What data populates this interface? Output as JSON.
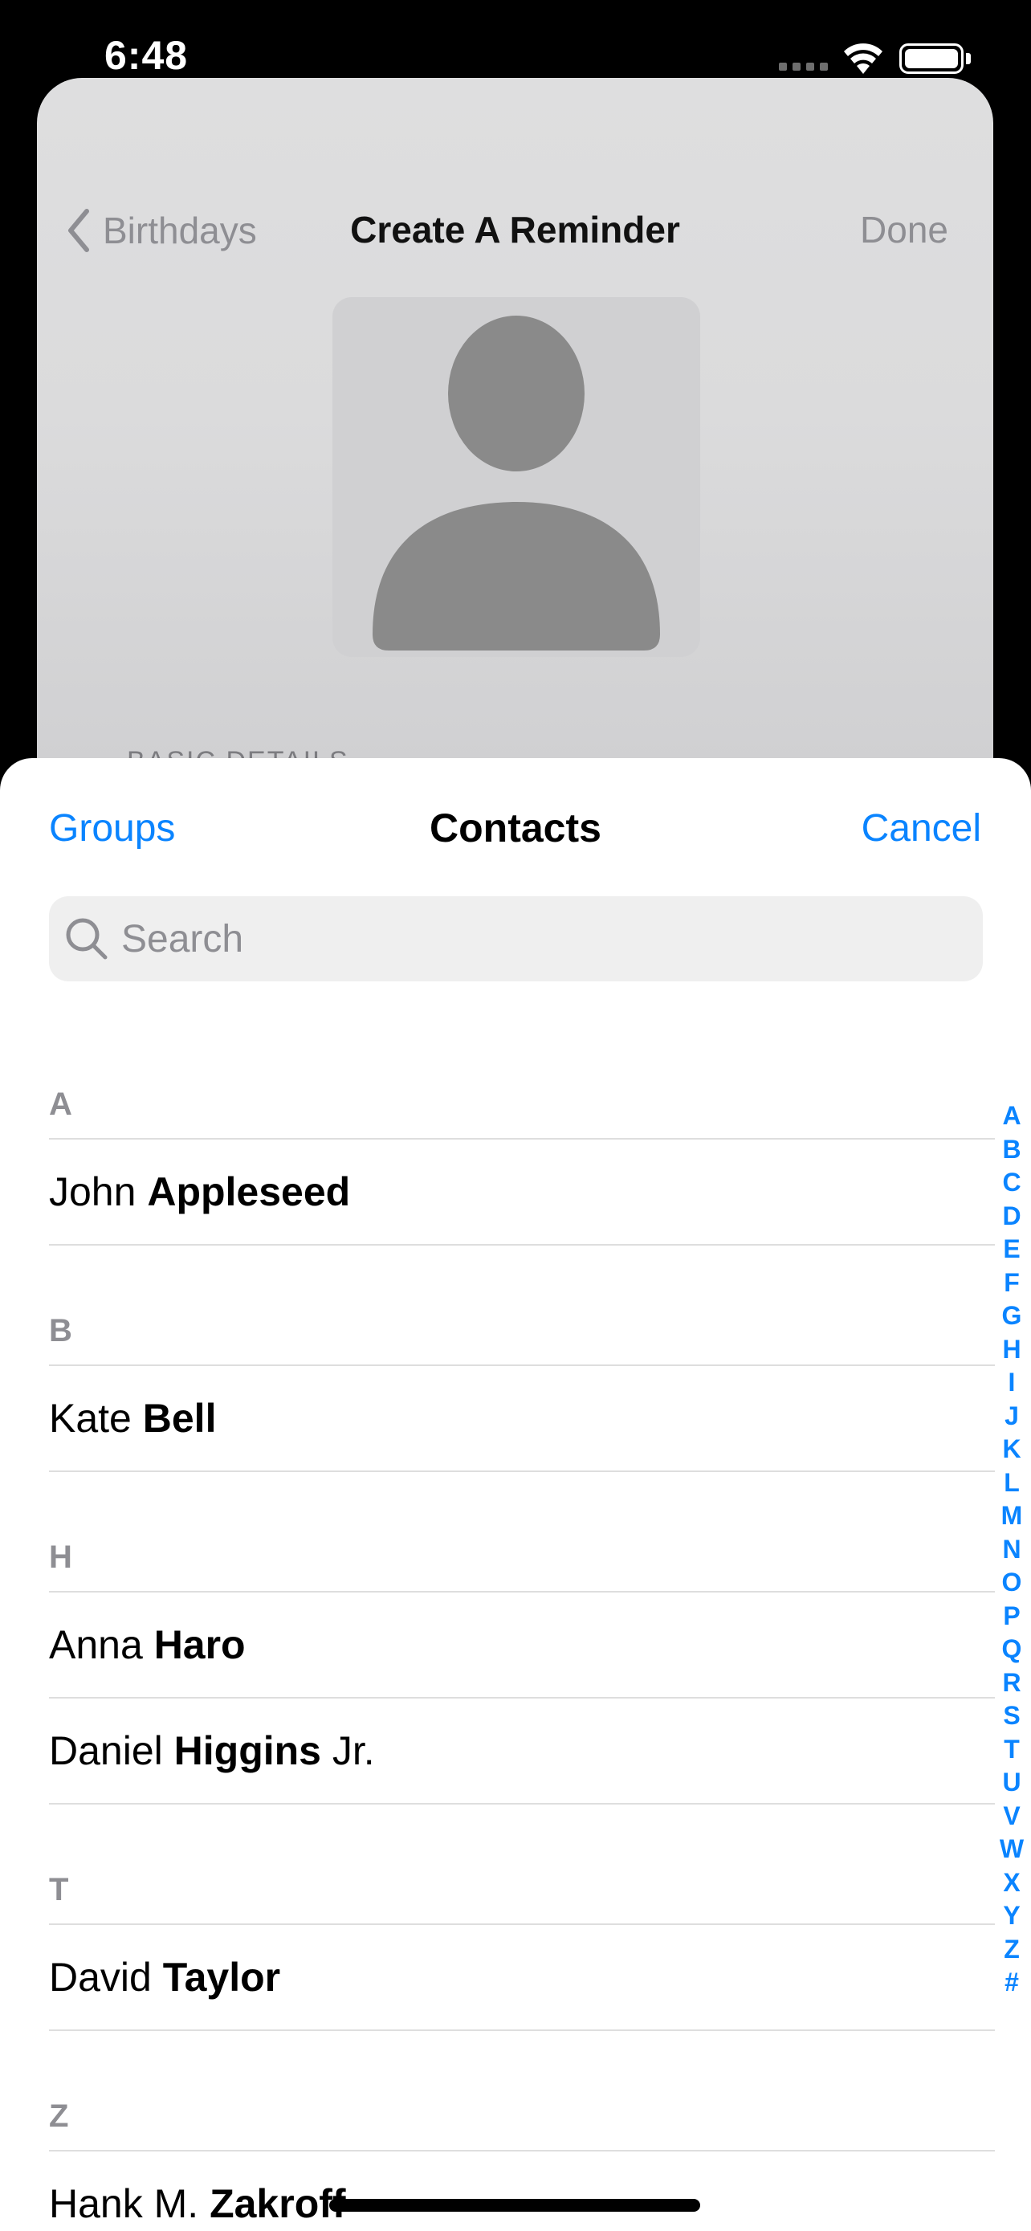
{
  "status_bar": {
    "time": "6:48"
  },
  "background_screen": {
    "back_label": "Birthdays",
    "title": "Create A Reminder",
    "done_label": "Done",
    "section_peek": "BASIC DETAILS"
  },
  "sheet": {
    "left_label": "Groups",
    "title": "Contacts",
    "right_label": "Cancel",
    "search_placeholder": "Search"
  },
  "sections": [
    {
      "letter": "A",
      "contacts": [
        {
          "first": "John",
          "last": "Appleseed",
          "suffix": ""
        }
      ]
    },
    {
      "letter": "B",
      "contacts": [
        {
          "first": "Kate",
          "last": "Bell",
          "suffix": ""
        }
      ]
    },
    {
      "letter": "H",
      "contacts": [
        {
          "first": "Anna",
          "last": "Haro",
          "suffix": ""
        },
        {
          "first": "Daniel",
          "last": "Higgins",
          "suffix": "Jr."
        }
      ]
    },
    {
      "letter": "T",
      "contacts": [
        {
          "first": "David",
          "last": "Taylor",
          "suffix": ""
        }
      ]
    },
    {
      "letter": "Z",
      "contacts": [
        {
          "first": "Hank M.",
          "last": "Zakroff",
          "suffix": ""
        }
      ]
    }
  ],
  "index_letters": [
    "A",
    "B",
    "C",
    "D",
    "E",
    "F",
    "G",
    "H",
    "I",
    "J",
    "K",
    "L",
    "M",
    "N",
    "O",
    "P",
    "Q",
    "R",
    "S",
    "T",
    "U",
    "V",
    "W",
    "X",
    "Y",
    "Z",
    "#"
  ],
  "colors": {
    "accent": "#0a84ff",
    "secondary_text": "#8e8e93",
    "placeholder_avatar": "#8a8a8a"
  }
}
